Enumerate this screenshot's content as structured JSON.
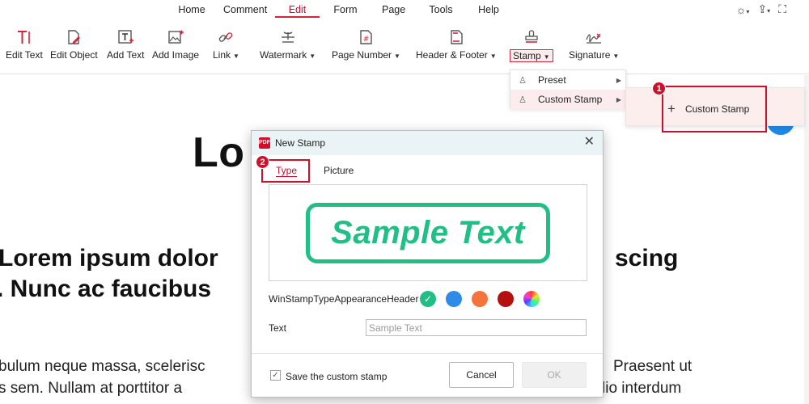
{
  "menu": {
    "tabs": [
      {
        "label": "Home"
      },
      {
        "label": "Comment"
      },
      {
        "label": "Edit"
      },
      {
        "label": "Form"
      },
      {
        "label": "Page"
      },
      {
        "label": "Tools"
      },
      {
        "label": "Help"
      }
    ],
    "active_tab": "Edit",
    "right_icons": [
      "theme-icon",
      "share-icon",
      "fullscreen-icon"
    ]
  },
  "toolbar": {
    "tools": [
      {
        "label": "Edit Text",
        "icon": "edit-text-icon"
      },
      {
        "label": "Edit Object",
        "icon": "edit-object-icon"
      },
      {
        "label": "Add Text",
        "icon": "add-text-icon"
      },
      {
        "label": "Add Image",
        "icon": "add-image-icon"
      },
      {
        "label": "Link",
        "icon": "link-icon",
        "has_dropdown": true
      },
      {
        "label": "Watermark",
        "icon": "watermark-icon",
        "has_dropdown": true
      },
      {
        "label": "Page Number",
        "icon": "page-number-icon",
        "has_dropdown": true
      },
      {
        "label": "Header & Footer",
        "icon": "header-footer-icon",
        "has_dropdown": true
      },
      {
        "label": "Stamp",
        "icon": "stamp-icon",
        "has_dropdown": true,
        "pressed": true
      },
      {
        "label": "Signature",
        "icon": "signature-icon",
        "has_dropdown": true
      }
    ],
    "caret": "▼"
  },
  "stamp_menu": {
    "items": [
      {
        "label": "Preset",
        "icon": "preset-stamp-icon"
      },
      {
        "label": "Custom Stamp",
        "icon": "custom-stamp-icon"
      }
    ],
    "submenu_item": "Custom Stamp"
  },
  "annotations": {
    "step1": "1",
    "step2": "2",
    "highlight_color": "#d0102a"
  },
  "document": {
    "title_fragment": "Lo",
    "heading_line1_left": "Lorem ipsum dolor",
    "heading_line1_right": "scing",
    "heading_line2_left": ". Nunc ac faucibus",
    "body_line1_left": "bulum neque massa, scelerisc",
    "body_line1_right": "Praesent ut",
    "body_line2_left": "s sem. Nullam at porttitor a",
    "body_line2_right": "lio interdum"
  },
  "dialog": {
    "title": "New Stamp",
    "app_logo_text": "PDF",
    "tabs": [
      {
        "label": "Type",
        "active": true
      },
      {
        "label": "Picture",
        "active": false
      }
    ],
    "stamp_preview_text": "Sample Text",
    "stamp_color": "#21bf85",
    "appearance_label": "WinStampTypeAppearanceHeader",
    "color_options": [
      {
        "name": "green",
        "color": "#21bf85",
        "selected": true
      },
      {
        "name": "blue",
        "color": "#2f8ae8",
        "selected": false
      },
      {
        "name": "orange",
        "color": "#f5743b",
        "selected": false
      },
      {
        "name": "dark-red",
        "color": "#b5100f",
        "selected": false
      },
      {
        "name": "rainbow",
        "color": "conic",
        "selected": false
      }
    ],
    "text_label": "Text",
    "text_placeholder": "Sample Text",
    "save_label": "Save the custom stamp",
    "save_checked": true,
    "cancel_label": "Cancel",
    "ok_label": "OK",
    "close_glyph": "✕"
  }
}
